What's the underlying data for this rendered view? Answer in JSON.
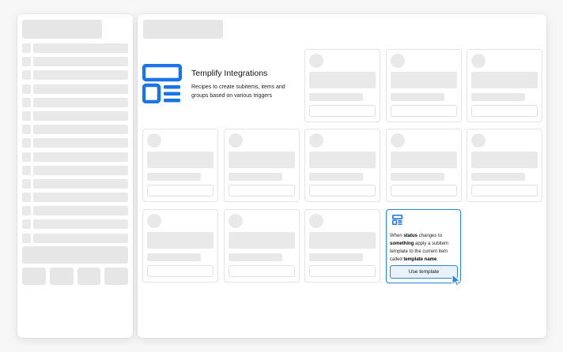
{
  "intro": {
    "title": "Templify Integrations",
    "description": "Recipes to create subitems, items and groups based on various triggers",
    "icon": "template-layout-icon",
    "accent_color": "#1a73e8"
  },
  "active_recipe": {
    "icon": "template-layout-icon",
    "text_1": "When ",
    "status": "status",
    "text_2": " changes to ",
    "something": "something",
    "text_3": " apply a subitem template to the current item called ",
    "template_name": "template name",
    "text_4": ".",
    "button_label": "Use template",
    "accent_color": "#2f86d6"
  }
}
